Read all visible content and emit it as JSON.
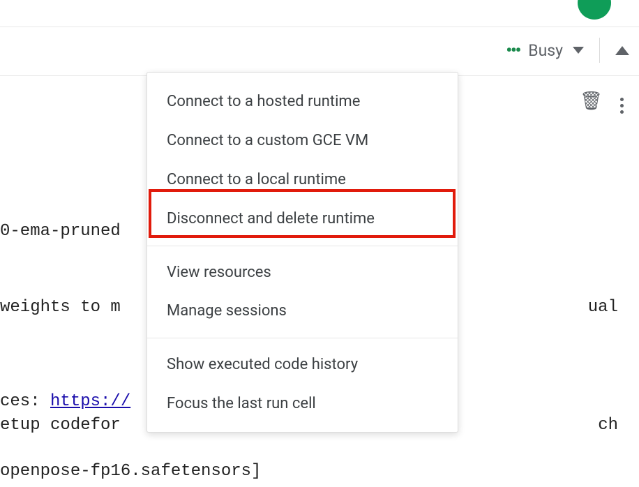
{
  "header": {
    "status_text": "Busy"
  },
  "dropdown": {
    "items": [
      {
        "label": "Connect to a hosted runtime",
        "highlighted": false
      },
      {
        "label": "Connect to a custom GCE VM",
        "highlighted": false
      },
      {
        "label": "Connect to a local runtime",
        "highlighted": false
      },
      {
        "label": "Disconnect and delete runtime",
        "highlighted": true
      }
    ],
    "items2": [
      {
        "label": "View resources"
      },
      {
        "label": "Manage sessions"
      }
    ],
    "items3": [
      {
        "label": "Show executed code history"
      },
      {
        "label": "Focus the last run cell"
      }
    ]
  },
  "background": {
    "line1": "0-ema-pruned",
    "line2": "weights to m",
    "line2b": "ual",
    "line3_prefix": "ces: ",
    "line3_link": "https://",
    "line4": "etup codefor",
    "line4b": "ch",
    "line5": "openpose-fp16.safetensors]"
  }
}
